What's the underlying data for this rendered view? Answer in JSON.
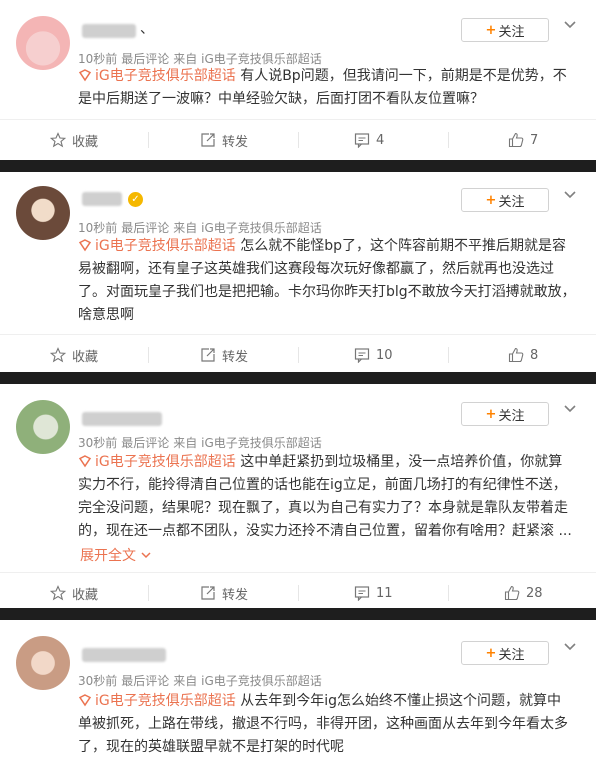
{
  "topic": "iG电子竞技俱乐部超话",
  "follow_label": "关注",
  "comments": [
    {
      "name_suffix": "、",
      "time": "10秒前",
      "tag": "最后评论",
      "source": "来自 iG电子竞技俱乐部超话",
      "text_lines": [
        {
          "topic": true,
          "text": " 有人说Bp问题，但我请问一下，前期是不是优势，不"
        },
        {
          "topic": false,
          "text": "是中后期送了一波嘛？中单经验欠缺，后面打团不看队友位置嘛？"
        }
      ],
      "actions": {
        "collect": "收藏",
        "repost": "转发",
        "comment": "4",
        "like": "7"
      }
    },
    {
      "name_suffix": "",
      "verified": true,
      "time": "10秒前",
      "tag": "最后评论",
      "source": "来自 iG电子竞技俱乐部超话",
      "text_lines": [
        {
          "topic": true,
          "text": " 怎么就不能怪bp了，这个阵容前期不平推后期就是容"
        },
        {
          "topic": false,
          "text": "易被翻啊，还有皇子这英雄我们这赛段每次玩好像都赢了，然后就再也没选过"
        },
        {
          "topic": false,
          "text": "了。对面玩皇子我们也是把把输。卡尔玛你昨天打blg不敢放今天打滔搏就敢放，"
        },
        {
          "topic": false,
          "text": "啥意思啊"
        }
      ],
      "actions": {
        "collect": "收藏",
        "repost": "转发",
        "comment": "10",
        "like": "8"
      }
    },
    {
      "name_suffix": "",
      "time": "30秒前",
      "tag": "最后评论",
      "source": "来自 iG电子竞技俱乐部超话",
      "text_lines": [
        {
          "topic": true,
          "text": " 这中单赶紧扔到垃圾桶里，没一点培养价值，你就算"
        },
        {
          "topic": false,
          "text": "实力不行，能拎得清自己位置的话也能在ig立足，前面几场打的有纪律性不送，"
        },
        {
          "topic": false,
          "text": "完全没问题，结果呢？现在飘了，真以为自己有实力了？本身就是靠队友带着走"
        },
        {
          "topic": false,
          "text": "的，现在还一点都不团队，没实力还拎不清自己位置，留着你有啥用？赶紧滚 ..."
        }
      ],
      "expand": "展开全文",
      "actions": {
        "collect": "收藏",
        "repost": "转发",
        "comment": "11",
        "like": "28"
      }
    },
    {
      "name_suffix": "",
      "time": "30秒前",
      "tag": "最后评论",
      "source": "来自 iG电子竞技俱乐部超话",
      "text_lines": [
        {
          "topic": true,
          "text": " 从去年到今年ig怎么始终不懂止损这个问题，就算中"
        },
        {
          "topic": false,
          "text": "单被抓死，上路在带线，撤退不行吗，非得开团，这种画面从去年到今年看太多"
        },
        {
          "topic": false,
          "text": "了，现在的英雄联盟早就不是打架的时代呢"
        }
      ]
    }
  ],
  "colors": {
    "topic": "#eb7350",
    "follow_plus": "#ff8200",
    "verified": "#f5b800",
    "meta": "#8a8a8a"
  }
}
